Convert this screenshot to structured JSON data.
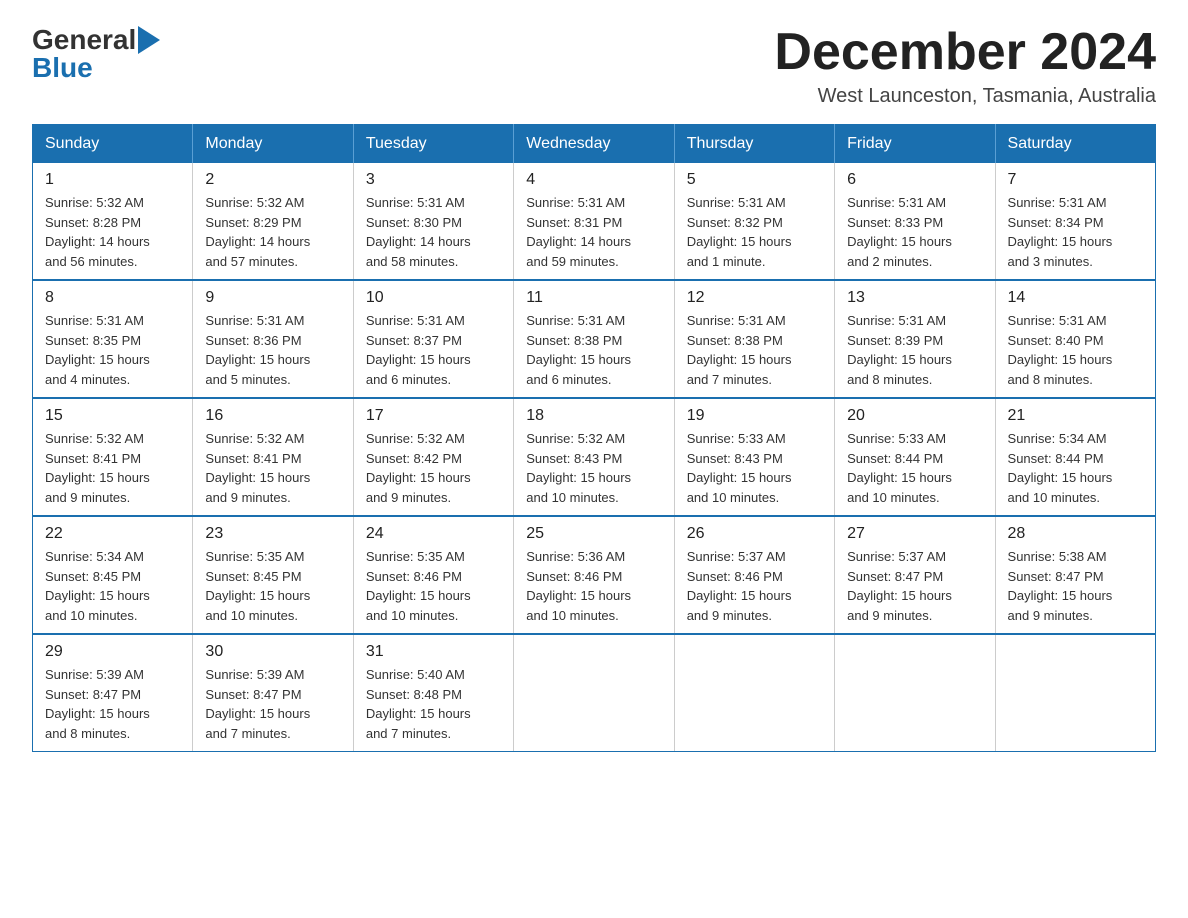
{
  "logo": {
    "general": "General",
    "blue": "Blue"
  },
  "title": "December 2024",
  "location": "West Launceston, Tasmania, Australia",
  "days_of_week": [
    "Sunday",
    "Monday",
    "Tuesday",
    "Wednesday",
    "Thursday",
    "Friday",
    "Saturday"
  ],
  "weeks": [
    [
      {
        "day": "1",
        "sunrise": "5:32 AM",
        "sunset": "8:28 PM",
        "daylight": "14 hours and 56 minutes."
      },
      {
        "day": "2",
        "sunrise": "5:32 AM",
        "sunset": "8:29 PM",
        "daylight": "14 hours and 57 minutes."
      },
      {
        "day": "3",
        "sunrise": "5:31 AM",
        "sunset": "8:30 PM",
        "daylight": "14 hours and 58 minutes."
      },
      {
        "day": "4",
        "sunrise": "5:31 AM",
        "sunset": "8:31 PM",
        "daylight": "14 hours and 59 minutes."
      },
      {
        "day": "5",
        "sunrise": "5:31 AM",
        "sunset": "8:32 PM",
        "daylight": "15 hours and 1 minute."
      },
      {
        "day": "6",
        "sunrise": "5:31 AM",
        "sunset": "8:33 PM",
        "daylight": "15 hours and 2 minutes."
      },
      {
        "day": "7",
        "sunrise": "5:31 AM",
        "sunset": "8:34 PM",
        "daylight": "15 hours and 3 minutes."
      }
    ],
    [
      {
        "day": "8",
        "sunrise": "5:31 AM",
        "sunset": "8:35 PM",
        "daylight": "15 hours and 4 minutes."
      },
      {
        "day": "9",
        "sunrise": "5:31 AM",
        "sunset": "8:36 PM",
        "daylight": "15 hours and 5 minutes."
      },
      {
        "day": "10",
        "sunrise": "5:31 AM",
        "sunset": "8:37 PM",
        "daylight": "15 hours and 6 minutes."
      },
      {
        "day": "11",
        "sunrise": "5:31 AM",
        "sunset": "8:38 PM",
        "daylight": "15 hours and 6 minutes."
      },
      {
        "day": "12",
        "sunrise": "5:31 AM",
        "sunset": "8:38 PM",
        "daylight": "15 hours and 7 minutes."
      },
      {
        "day": "13",
        "sunrise": "5:31 AM",
        "sunset": "8:39 PM",
        "daylight": "15 hours and 8 minutes."
      },
      {
        "day": "14",
        "sunrise": "5:31 AM",
        "sunset": "8:40 PM",
        "daylight": "15 hours and 8 minutes."
      }
    ],
    [
      {
        "day": "15",
        "sunrise": "5:32 AM",
        "sunset": "8:41 PM",
        "daylight": "15 hours and 9 minutes."
      },
      {
        "day": "16",
        "sunrise": "5:32 AM",
        "sunset": "8:41 PM",
        "daylight": "15 hours and 9 minutes."
      },
      {
        "day": "17",
        "sunrise": "5:32 AM",
        "sunset": "8:42 PM",
        "daylight": "15 hours and 9 minutes."
      },
      {
        "day": "18",
        "sunrise": "5:32 AM",
        "sunset": "8:43 PM",
        "daylight": "15 hours and 10 minutes."
      },
      {
        "day": "19",
        "sunrise": "5:33 AM",
        "sunset": "8:43 PM",
        "daylight": "15 hours and 10 minutes."
      },
      {
        "day": "20",
        "sunrise": "5:33 AM",
        "sunset": "8:44 PM",
        "daylight": "15 hours and 10 minutes."
      },
      {
        "day": "21",
        "sunrise": "5:34 AM",
        "sunset": "8:44 PM",
        "daylight": "15 hours and 10 minutes."
      }
    ],
    [
      {
        "day": "22",
        "sunrise": "5:34 AM",
        "sunset": "8:45 PM",
        "daylight": "15 hours and 10 minutes."
      },
      {
        "day": "23",
        "sunrise": "5:35 AM",
        "sunset": "8:45 PM",
        "daylight": "15 hours and 10 minutes."
      },
      {
        "day": "24",
        "sunrise": "5:35 AM",
        "sunset": "8:46 PM",
        "daylight": "15 hours and 10 minutes."
      },
      {
        "day": "25",
        "sunrise": "5:36 AM",
        "sunset": "8:46 PM",
        "daylight": "15 hours and 10 minutes."
      },
      {
        "day": "26",
        "sunrise": "5:37 AM",
        "sunset": "8:46 PM",
        "daylight": "15 hours and 9 minutes."
      },
      {
        "day": "27",
        "sunrise": "5:37 AM",
        "sunset": "8:47 PM",
        "daylight": "15 hours and 9 minutes."
      },
      {
        "day": "28",
        "sunrise": "5:38 AM",
        "sunset": "8:47 PM",
        "daylight": "15 hours and 9 minutes."
      }
    ],
    [
      {
        "day": "29",
        "sunrise": "5:39 AM",
        "sunset": "8:47 PM",
        "daylight": "15 hours and 8 minutes."
      },
      {
        "day": "30",
        "sunrise": "5:39 AM",
        "sunset": "8:47 PM",
        "daylight": "15 hours and 7 minutes."
      },
      {
        "day": "31",
        "sunrise": "5:40 AM",
        "sunset": "8:48 PM",
        "daylight": "15 hours and 7 minutes."
      },
      null,
      null,
      null,
      null
    ]
  ]
}
